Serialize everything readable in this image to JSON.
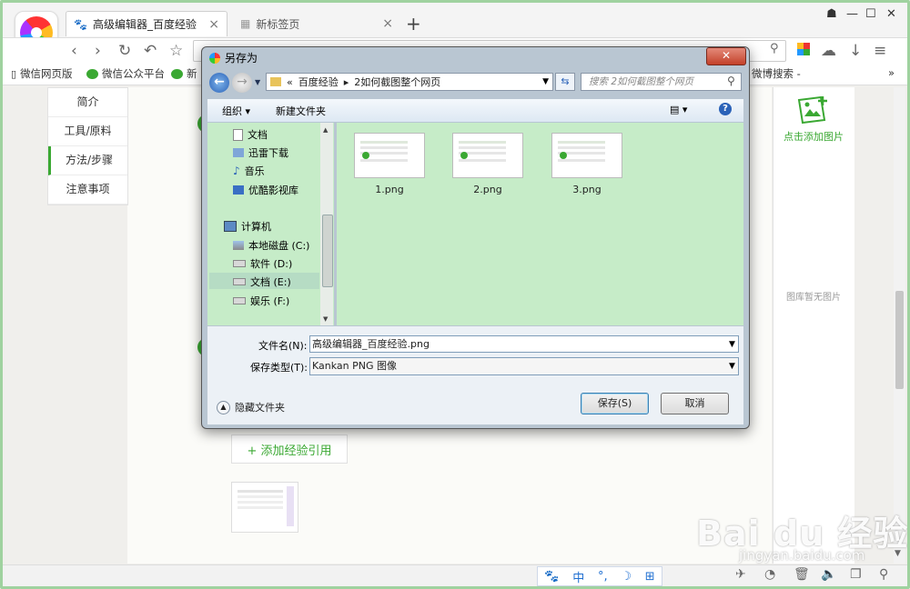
{
  "browser": {
    "tabs": [
      {
        "label": "高级编辑器_百度经验",
        "close": "×"
      },
      {
        "label": "新标签页",
        "close": "×"
      }
    ],
    "new_tab": "+",
    "window_controls": {
      "skin": "☗",
      "minimize": "—",
      "maximize": "☐",
      "close": "✕"
    },
    "bookmarks": [
      {
        "label": "微信网页版"
      },
      {
        "label": "微信公众平台"
      },
      {
        "label": "新"
      },
      {
        "label": "微博搜索 -"
      }
    ],
    "bookmarks_more": "»"
  },
  "page": {
    "left_nav": [
      "简介",
      "工具/原料",
      "方法/步骤",
      "注意事项"
    ],
    "add_reference": "+ 添加经验引用",
    "right_panel": {
      "add_image": "点击添加图片",
      "empty": "图库暂无图片"
    },
    "ime_bar": [
      "🐾",
      "中",
      "°,",
      "☽",
      "⊞"
    ]
  },
  "watermark": {
    "brand": "Bai du 经验",
    "url": "jingyan.baidu.com"
  },
  "dialog": {
    "title": "另存为",
    "close": "✕",
    "path": [
      "«",
      "百度经验",
      "▸",
      "2如何截图整个网页"
    ],
    "search_placeholder": "搜索 2如何截图整个网页",
    "toolbar": {
      "organize": "组织 ▾",
      "new_folder": "新建文件夹",
      "help": "?"
    },
    "tree": [
      {
        "label": "文档",
        "icon": "document-icon"
      },
      {
        "label": "迅雷下载",
        "icon": "download-icon"
      },
      {
        "label": "音乐",
        "icon": "music-icon"
      },
      {
        "label": "优酷影视库",
        "icon": "video-icon"
      },
      {
        "label": "计算机",
        "icon": "computer-icon"
      },
      {
        "label": "本地磁盘 (C:)",
        "icon": "disk-icon"
      },
      {
        "label": "软件 (D:)",
        "icon": "drive-icon"
      },
      {
        "label": "文档 (E:)",
        "icon": "drive-icon"
      },
      {
        "label": "娱乐 (F:)",
        "icon": "drive-icon"
      }
    ],
    "files": [
      "1.png",
      "2.png",
      "3.png"
    ],
    "filename_label": "文件名(N):",
    "filename_value": "高级编辑器_百度经验.png",
    "filetype_label": "保存类型(T):",
    "filetype_value": "Kankan PNG 图像",
    "hide_folders": "隐藏文件夹",
    "save_button": "保存(S)",
    "cancel_button": "取消"
  },
  "colors": {
    "accent_green": "#3aa832",
    "dialog_frame": "#b9c6d2",
    "file_area": "#c6ecc8"
  }
}
